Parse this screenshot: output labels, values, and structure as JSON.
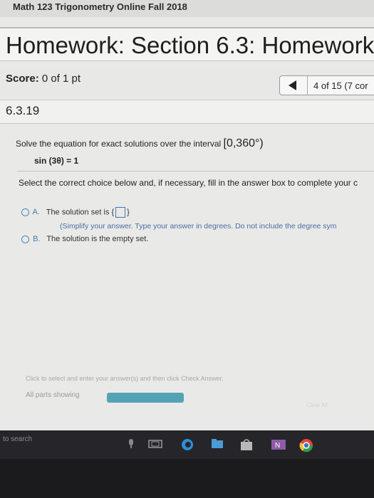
{
  "course": {
    "title": "Math 123 Trigonometry Online Fall 2018"
  },
  "homework": {
    "title": "Homework: Section 6.3: Homework"
  },
  "score": {
    "label": "Score:",
    "value": "0 of 1 pt"
  },
  "navigation": {
    "position": "4 of 15 (7 cor"
  },
  "question": {
    "number": "6.3.19",
    "prompt": "Solve the equation for exact solutions over the interval",
    "interval": "[0,360°)",
    "equation": "sin (3θ) = 1",
    "instruction": "Select the correct choice below and, if necessary, fill in the answer box to complete your c"
  },
  "choices": [
    {
      "letter": "A.",
      "text": "The solution set is",
      "hint": "(Simplify your answer. Type your answer in degrees. Do not include the degree sym"
    },
    {
      "letter": "B.",
      "text": "The solution is the empty set."
    }
  ],
  "footer": {
    "instruction": "Click to select and enter your answer(s) and then click Check Answer.",
    "parts": "All parts showing",
    "check_button": "Clear All"
  },
  "taskbar": {
    "search": "to search"
  },
  "colors": {
    "accent": "#3b78c2",
    "progress": "#54a3b5"
  }
}
